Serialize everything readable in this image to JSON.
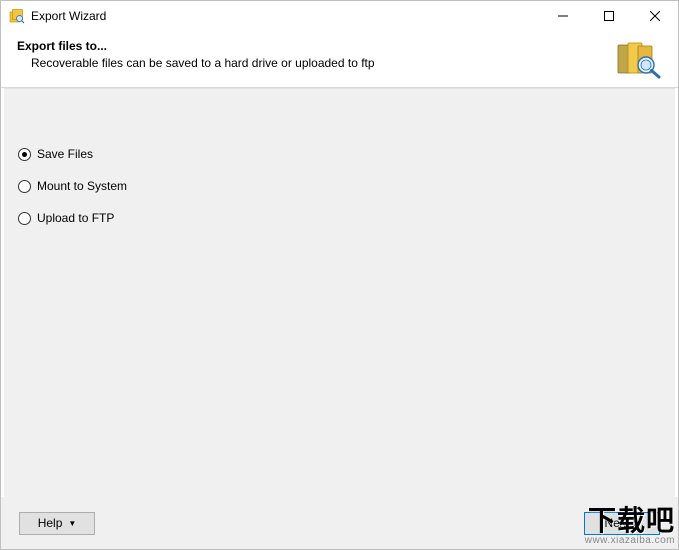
{
  "titlebar": {
    "title": "Export Wizard"
  },
  "header": {
    "heading": "Export files to...",
    "subtext": "Recoverable files can be saved to a hard drive or uploaded to ftp"
  },
  "options": {
    "save_files": {
      "label": "Save Files",
      "selected": true
    },
    "mount_system": {
      "label": "Mount to System",
      "selected": false
    },
    "upload_ftp": {
      "label": "Upload to FTP",
      "selected": false
    }
  },
  "footer": {
    "help_label": "Help",
    "next_label": "Next >"
  },
  "watermark": {
    "brand": "下载吧",
    "url": "www.xiazaiba.com"
  }
}
